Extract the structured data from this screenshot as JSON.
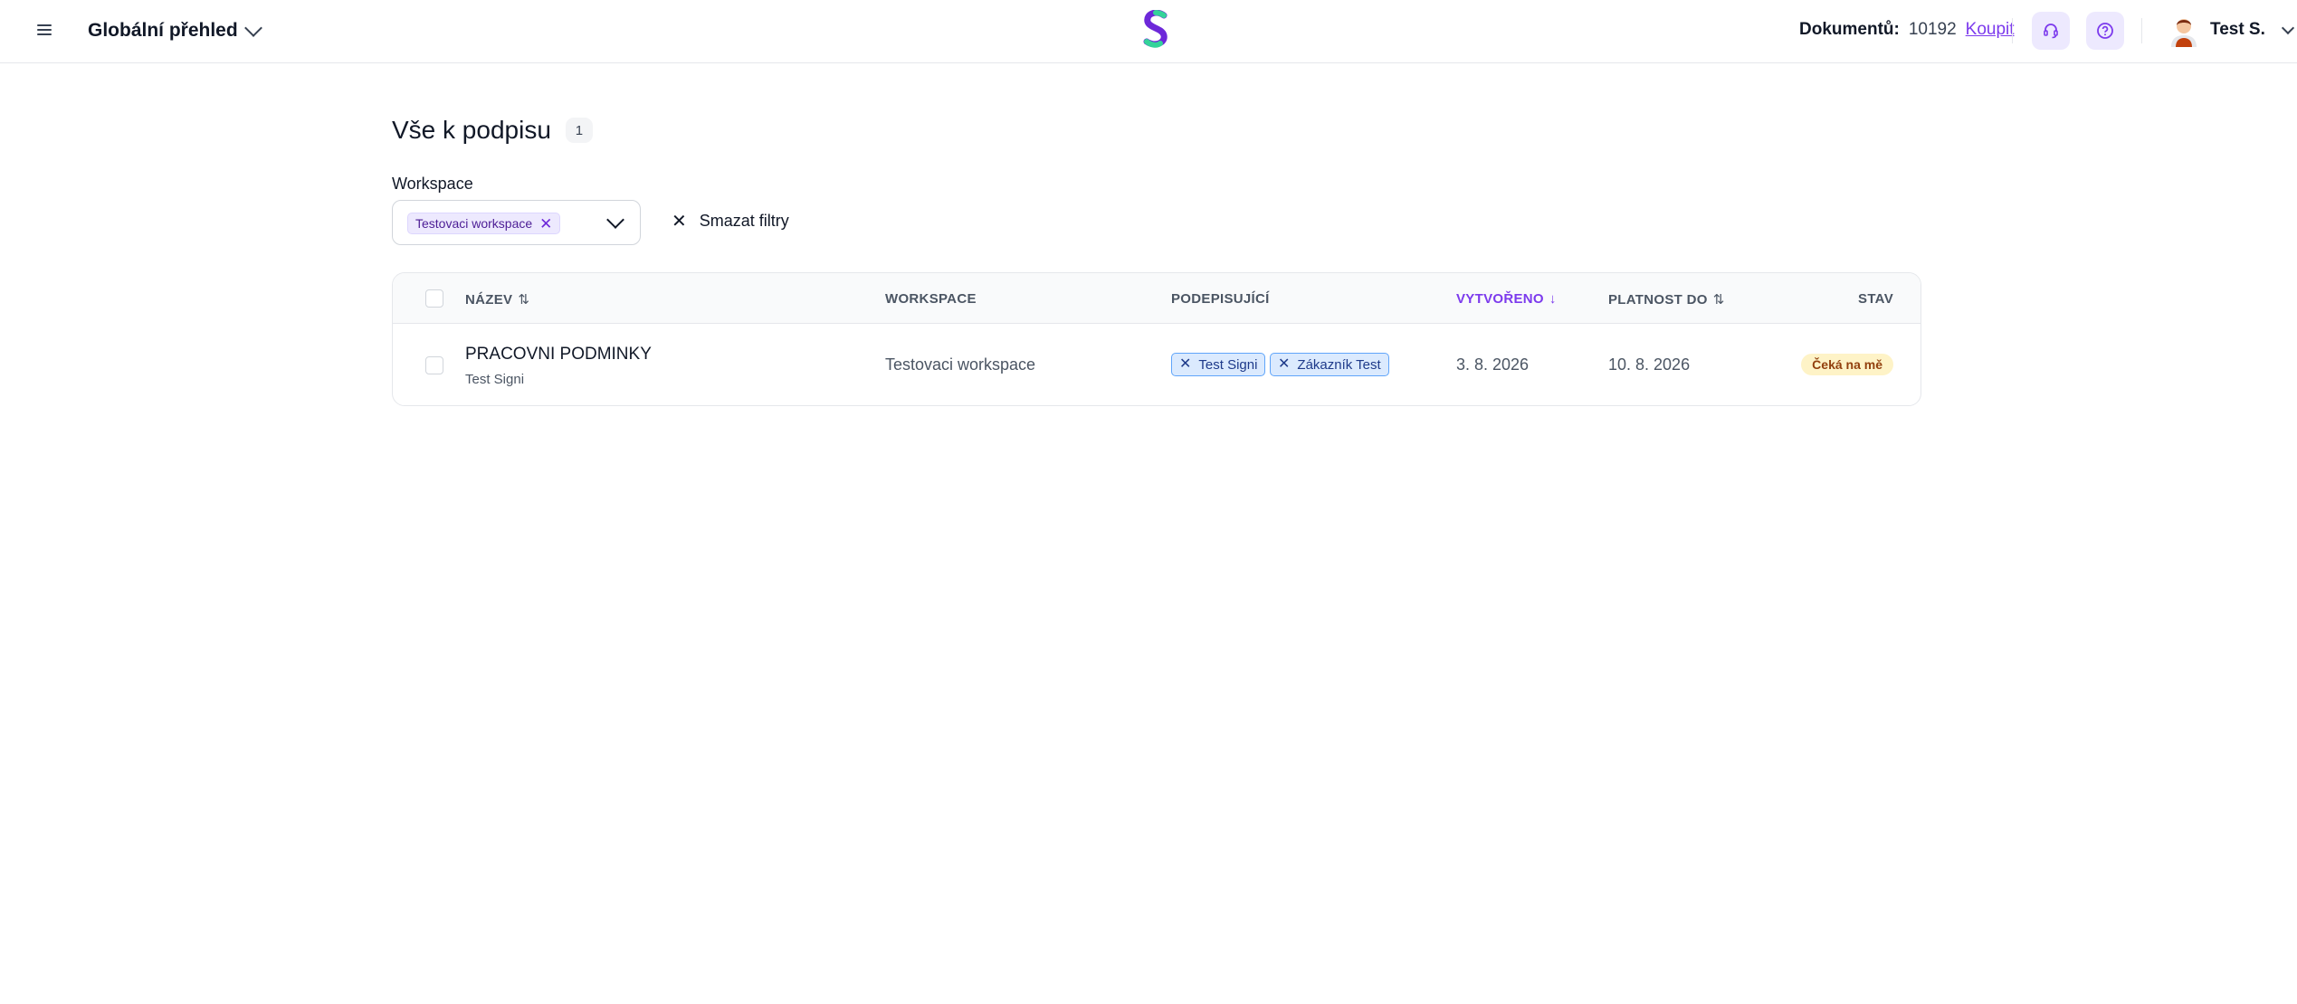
{
  "header": {
    "view_title": "Globální přehled",
    "documents_label": "Dokumentů:",
    "documents_count": "10192",
    "buy_label": "Koupit",
    "user_name": "Test S.",
    "colors": {
      "accent": "#7c3aed",
      "icon_bg": "#ede9fe",
      "logo_purple": "#6d28d9",
      "logo_green": "#34d399"
    },
    "icons": [
      "menu-icon",
      "chevron-down-icon",
      "headset-icon",
      "help-icon",
      "avatar"
    ]
  },
  "page": {
    "title": "Vše k podpisu",
    "count": "1"
  },
  "filters": {
    "workspace_label": "Workspace",
    "selected_workspace": "Testovaci workspace",
    "clear_label": "Smazat filtry"
  },
  "table": {
    "columns": {
      "name": "NÁZEV",
      "workspace": "WORKSPACE",
      "signers": "PODEPISUJÍCÍ",
      "created": "VYTVOŘENO",
      "valid_until": "PLATNOST DO",
      "status": "STAV"
    },
    "rows": [
      {
        "name": "PRACOVNI PODMINKY",
        "owner": "Test Signi",
        "workspace": "Testovaci workspace",
        "signers": [
          "Test Signi",
          "Zákazník Test"
        ],
        "created": "3. 8. 2026",
        "valid_until": "10. 8. 2026",
        "status": "Čeká na mě"
      }
    ]
  }
}
